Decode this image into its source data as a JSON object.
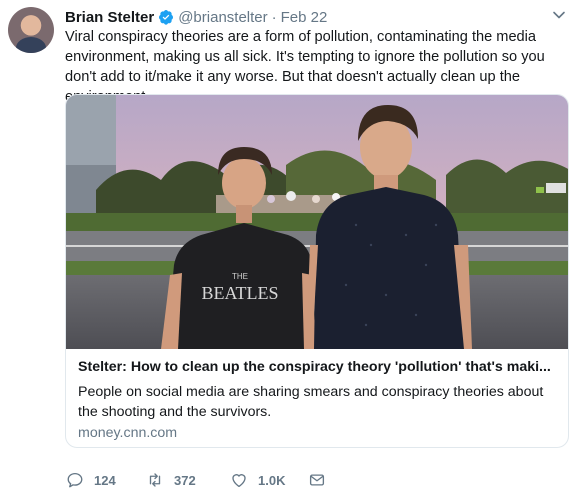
{
  "author": {
    "name": "Brian Stelter",
    "handle": "@brianstelter",
    "separator": "·",
    "date": "Feb 22"
  },
  "tweet_text": "Viral conspiracy theories are a form of pollution, contaminating the media environment, making us all sick. It's tempting to ignore the pollution so you don't add to it/make it any worse. But that doesn't actually clean up the environment.",
  "card": {
    "title": "Stelter: How to clean up the conspiracy theory 'pollution' that's maki...",
    "description": "People on social media are sharing smears and conspiracy theories about the shooting and the survivors.",
    "domain": "money.cnn.com",
    "image": {
      "shirt_text_top": "THE",
      "shirt_text_main": "BEATLES"
    }
  },
  "actions": {
    "reply_count": "124",
    "retweet_count": "372",
    "like_count": "1.0K"
  },
  "colors": {
    "text": "#14171a",
    "secondary": "#657786",
    "verified": "#1da1f2",
    "border": "#e1e8ed"
  },
  "icons": [
    "avatar",
    "verified-badge-icon",
    "caret-down-icon",
    "reply-icon",
    "retweet-icon",
    "like-icon",
    "direct-message-icon"
  ]
}
